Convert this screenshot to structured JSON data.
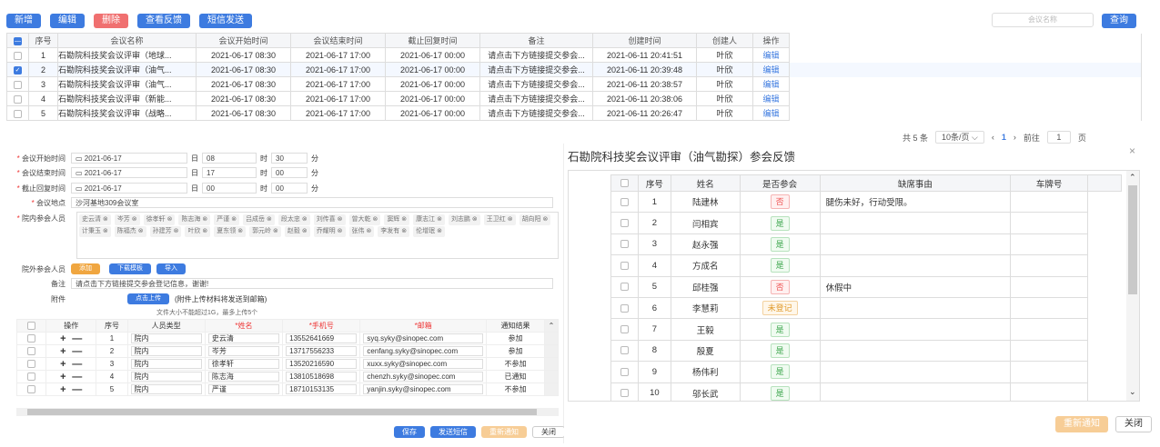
{
  "toolbar": {
    "add": "新增",
    "edit": "编辑",
    "delete": "删除",
    "feedback": "查看反馈",
    "sms": "短信发送"
  },
  "search": {
    "placeholder": "会议名称",
    "button": "查询"
  },
  "table": {
    "headers": [
      "序号",
      "会议名称",
      "会议开始时间",
      "会议结束时间",
      "截止回复时间",
      "备注",
      "创建时间",
      "创建人",
      "操作"
    ],
    "rows": [
      {
        "no": "1",
        "name": "石勘院科技奖会议评审（地球...",
        "start": "2021-06-17 08:30",
        "end": "2021-06-17 17:00",
        "deadline": "2021-06-17 00:00",
        "note": "请点击下方链接提交参会...",
        "created": "2021-06-11 20:41:51",
        "creator": "叶欣",
        "op": "编辑"
      },
      {
        "no": "2",
        "name": "石勘院科技奖会议评审（油气...",
        "start": "2021-06-17 08:30",
        "end": "2021-06-17 17:00",
        "deadline": "2021-06-17 00:00",
        "note": "请点击下方链接提交参会...",
        "created": "2021-06-11 20:39:48",
        "creator": "叶欣",
        "op": "编辑"
      },
      {
        "no": "3",
        "name": "石勘院科技奖会议评审（油气...",
        "start": "2021-06-17 08:30",
        "end": "2021-06-17 17:00",
        "deadline": "2021-06-17 00:00",
        "note": "请点击下方链接提交参会...",
        "created": "2021-06-11 20:38:57",
        "creator": "叶欣",
        "op": "编辑"
      },
      {
        "no": "4",
        "name": "石勘院科技奖会议评审（新能...",
        "start": "2021-06-17 08:30",
        "end": "2021-06-17 17:00",
        "deadline": "2021-06-17 00:00",
        "note": "请点击下方链接提交参会...",
        "created": "2021-06-11 20:38:06",
        "creator": "叶欣",
        "op": "编辑"
      },
      {
        "no": "5",
        "name": "石勘院科技奖会议评审（战略...",
        "start": "2021-06-17 08:30",
        "end": "2021-06-17 17:00",
        "deadline": "2021-06-17 00:00",
        "note": "请点击下方链接提交参会...",
        "created": "2021-06-11 20:26:47",
        "creator": "叶欣",
        "op": "编辑"
      }
    ]
  },
  "pager": {
    "total": "共 5 条",
    "size": "10条/页",
    "prev": "‹",
    "page": "1",
    "next": "›",
    "goto": "前往",
    "goto_val": "1",
    "unit": "页"
  },
  "form": {
    "start_label": "会议开始时间",
    "start_date": "2021-06-17",
    "start_day": "日",
    "start_h": "08",
    "hour": "时",
    "start_m": "30",
    "minute": "分",
    "end_label": "会议结束时间",
    "end_date": "2021-06-17",
    "end_day": "日",
    "end_h": "17",
    "end_m": "00",
    "deadline_label": "截止回复时间",
    "deadline_date": "2021-06-17",
    "deadline_day": "日",
    "deadline_h": "00",
    "deadline_m": "00",
    "place_label": "会议地点",
    "place": "沙河基地309会议室",
    "internal_label": "院内参会人员",
    "internal": [
      "史云清",
      "岑芳",
      "徐孝轩",
      "陈志海",
      "严谨",
      "吕成岳",
      "段太忠",
      "刘传喜",
      "曾大乾",
      "窦辉",
      "康志江",
      "刘志鹏",
      "王卫红",
      "胡向阳",
      "计秉玉",
      "陈福杰",
      "孙建芳",
      "叶欣",
      "夏东领",
      "郭元岭",
      "赵毅",
      "乔耀明",
      "张伟",
      "李发有",
      "伦增珉"
    ],
    "external_label": "院外参会人员",
    "add": "添加",
    "download": "下载模板",
    "import": "导入",
    "note_label": "备注",
    "note": "请点击下方链接提交参会登记信息，谢谢!",
    "attach_label": "附件",
    "upload": "点击上传",
    "upload_tip": "(附件上传材料将发送到邮箱)",
    "size_tip": "文件大小不能超过1G，最多上传5个"
  },
  "sub": {
    "headers": [
      "操作",
      "序号",
      "人员类型",
      "*姓名",
      "*手机号",
      "*邮箱",
      "通知结果"
    ],
    "rows": [
      {
        "no": "1",
        "type": "院内",
        "name": "史云清",
        "phone": "13552641669",
        "email": "syq.syky@sinopec.com",
        "result": "参加"
      },
      {
        "no": "2",
        "type": "院内",
        "name": "岑芳",
        "phone": "13717556233",
        "email": "cenfang.syky@sinopec.com",
        "result": "参加"
      },
      {
        "no": "3",
        "type": "院内",
        "name": "徐孝轩",
        "phone": "13520216590",
        "email": "xuxx.syky@sinopec.com",
        "result": "不参加"
      },
      {
        "no": "4",
        "type": "院内",
        "name": "陈志海",
        "phone": "13810518698",
        "email": "chenzh.syky@sinopec.com",
        "result": "已通知"
      },
      {
        "no": "5",
        "type": "院内",
        "name": "严谨",
        "phone": "18710153135",
        "email": "yanjin.syky@sinopec.com",
        "result": "不参加"
      }
    ]
  },
  "footer": {
    "save": "保存",
    "send": "发送短信",
    "renotify": "重新通知",
    "close": "关闭"
  },
  "modal": {
    "title": "石勘院科技奖会议评审（油气勘探）参会反馈",
    "close": "×",
    "headers": [
      "序号",
      "姓名",
      "是否参会",
      "缺席事由",
      "车牌号"
    ],
    "rows": [
      {
        "no": "1",
        "name": "陆建林",
        "status": "否",
        "kind": "no",
        "reason": "腿伤未好，行动受限。"
      },
      {
        "no": "2",
        "name": "闫相宾",
        "status": "是",
        "kind": "yes",
        "reason": ""
      },
      {
        "no": "3",
        "name": "赵永强",
        "status": "是",
        "kind": "yes",
        "reason": ""
      },
      {
        "no": "4",
        "name": "方成名",
        "status": "是",
        "kind": "yes",
        "reason": ""
      },
      {
        "no": "5",
        "name": "邱桂强",
        "status": "否",
        "kind": "no",
        "reason": "休假中"
      },
      {
        "no": "6",
        "name": "李慧莉",
        "status": "未登记",
        "kind": "un",
        "reason": ""
      },
      {
        "no": "7",
        "name": "王毅",
        "status": "是",
        "kind": "yes",
        "reason": ""
      },
      {
        "no": "8",
        "name": "殷夏",
        "status": "是",
        "kind": "yes",
        "reason": ""
      },
      {
        "no": "9",
        "name": "杨伟利",
        "status": "是",
        "kind": "yes",
        "reason": ""
      },
      {
        "no": "10",
        "name": "邬长武",
        "status": "是",
        "kind": "yes",
        "reason": ""
      }
    ],
    "renotify": "重新通知",
    "close_btn": "关闭"
  }
}
